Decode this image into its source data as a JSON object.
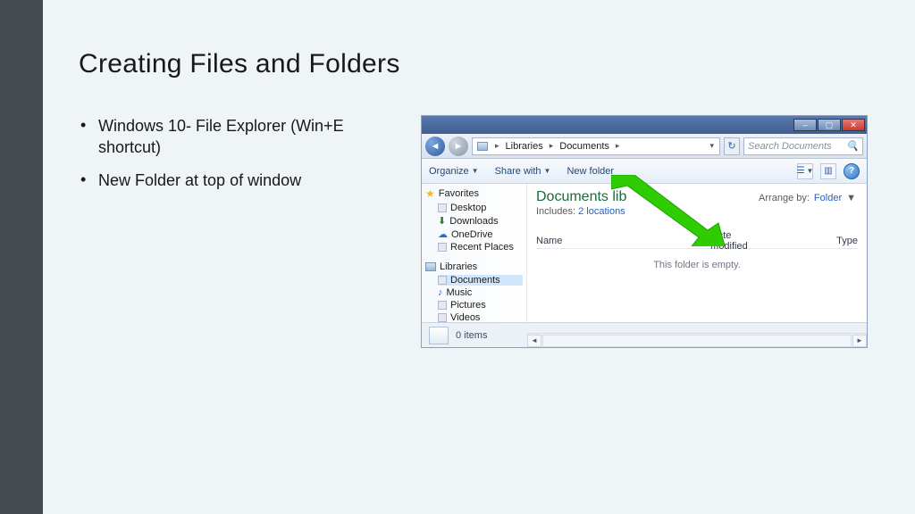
{
  "slide": {
    "title": "Creating Files and Folders",
    "bullets": [
      "Windows 10- File Explorer (Win+E shortcut)",
      "New Folder at top of window"
    ]
  },
  "explorer": {
    "breadcrumb": [
      "Libraries",
      "Documents"
    ],
    "search_placeholder": "Search Documents",
    "toolbar": {
      "organize": "Organize",
      "share_with": "Share with",
      "new_folder": "New folder"
    },
    "sidebar": {
      "favorites": "Favorites",
      "favorites_items": [
        "Desktop",
        "Downloads",
        "OneDrive",
        "Recent Places"
      ],
      "libraries": "Libraries",
      "libraries_items": [
        "Documents",
        "Music",
        "Pictures",
        "Videos"
      ]
    },
    "lib_title": "Documents lib",
    "includes_label": "Includes:",
    "includes_locations": "2 locations",
    "arrange_label": "Arrange by:",
    "arrange_value": "Folder",
    "columns": [
      "Name",
      "Date modified",
      "Type"
    ],
    "empty_text": "This folder is empty.",
    "status_items": "0 items"
  }
}
